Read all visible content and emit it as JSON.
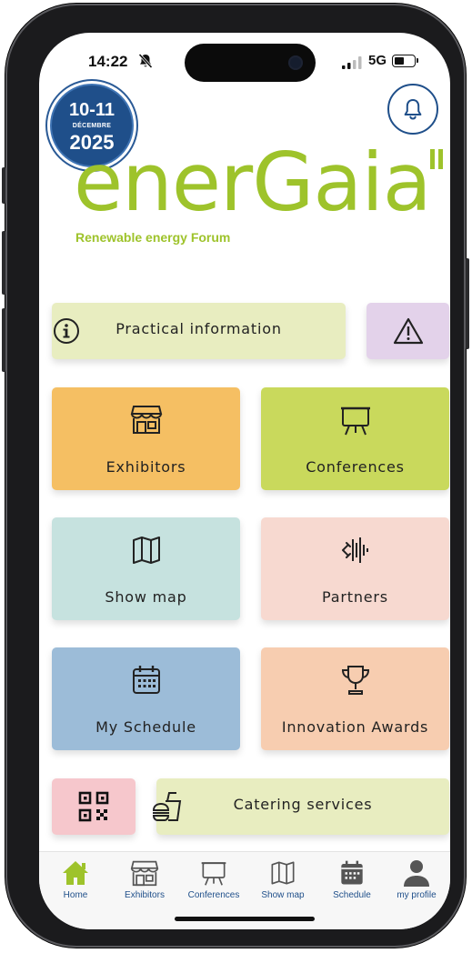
{
  "status_bar": {
    "time": "14:22",
    "network": "5G",
    "battery_level": 0.5
  },
  "event": {
    "days": "10-11",
    "month": "DÉCEMBRE",
    "year": "2025"
  },
  "brand": {
    "name": "enerGaia",
    "tagline": "Renewable energy Forum",
    "color": "#9ec32b"
  },
  "tiles": {
    "practical": {
      "label": "Practical information",
      "icon": "info-icon",
      "color": "#e8edc0"
    },
    "alert": {
      "icon": "warning-icon",
      "color": "#e3d2ea"
    },
    "exhibitors": {
      "label": "Exhibitors",
      "icon": "store-icon",
      "color": "#f5bf63"
    },
    "conferences": {
      "label": "Conferences",
      "icon": "easel-icon",
      "color": "#c9d95c"
    },
    "show_map": {
      "label": "Show map",
      "icon": "map-icon",
      "color": "#c6e2df"
    },
    "partners": {
      "label": "Partners",
      "icon": "partners-icon",
      "color": "#f7d9d0"
    },
    "my_schedule": {
      "label": "My Schedule",
      "icon": "calendar-icon",
      "color": "#9cbcd8"
    },
    "innovation": {
      "label": "Innovation Awards",
      "icon": "trophy-icon",
      "color": "#f7cdb0"
    },
    "qr": {
      "icon": "qr-code-icon",
      "color": "#f6c7cc"
    },
    "catering": {
      "label": "Catering services",
      "icon": "food-icon",
      "color": "#e8edc0"
    }
  },
  "tabbar": {
    "items": [
      {
        "label": "Home",
        "icon": "home-icon",
        "active": true
      },
      {
        "label": "Exhibitors",
        "icon": "store-icon"
      },
      {
        "label": "Conferences",
        "icon": "easel-icon"
      },
      {
        "label": "Show map",
        "icon": "map-icon"
      },
      {
        "label": "Schedule",
        "icon": "calendar-icon"
      },
      {
        "label": "my profile",
        "icon": "user-icon"
      }
    ],
    "active_color": "#9ec32b",
    "label_color": "#1f4f8a"
  }
}
